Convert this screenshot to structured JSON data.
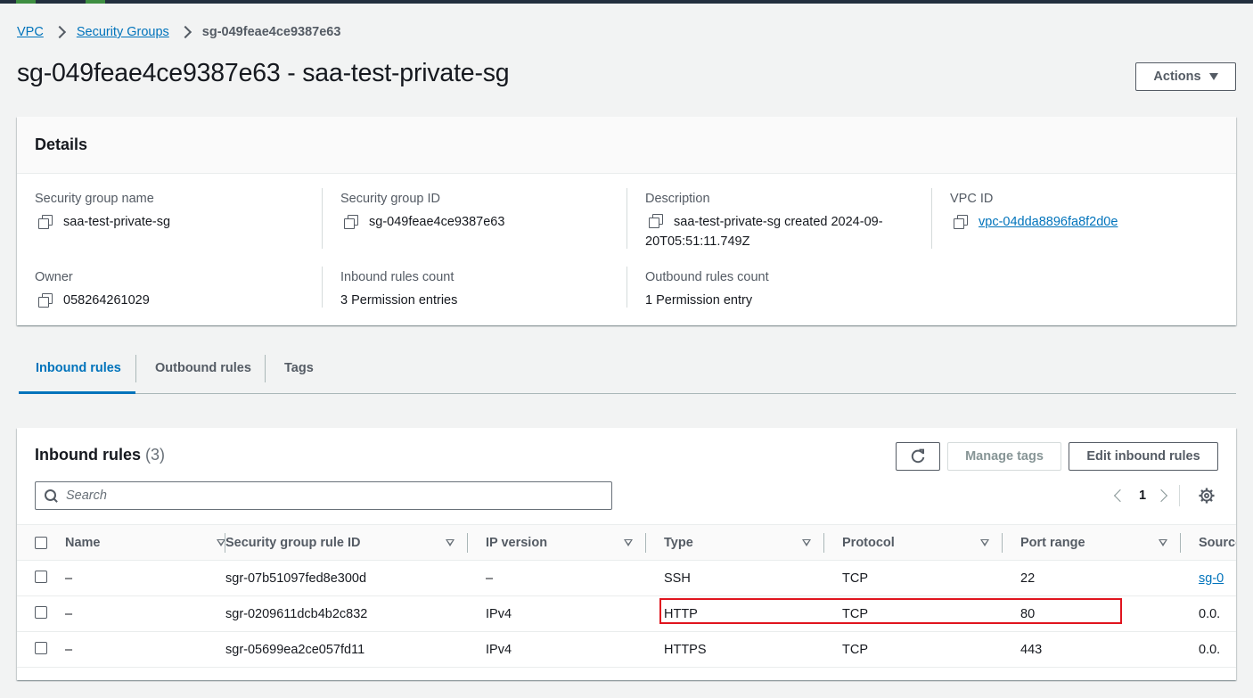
{
  "colors": {
    "link": "#0073bb",
    "highlight": "#e0141e",
    "topbar": "#232f3e"
  },
  "breadcrumb": {
    "items": [
      "VPC",
      "Security Groups"
    ],
    "current": "sg-049feae4ce9387e63"
  },
  "page": {
    "title": "sg-049feae4ce9387e63 - saa-test-private-sg",
    "actions_label": "Actions"
  },
  "details": {
    "heading": "Details",
    "fields": [
      {
        "label": "Security group name",
        "value": "saa-test-private-sg"
      },
      {
        "label": "Security group ID",
        "value": "sg-049feae4ce9387e63"
      },
      {
        "label": "Description",
        "value": "saa-test-private-sg created 2024-09-20T05:51:11.749Z"
      },
      {
        "label": "VPC ID",
        "value": "vpc-04dda8896fa8f2d0e"
      },
      {
        "label": "Owner",
        "value": "058264261029"
      },
      {
        "label": "Inbound rules count",
        "value": "3 Permission entries"
      },
      {
        "label": "Outbound rules count",
        "value": "1 Permission entry"
      }
    ]
  },
  "tabs": [
    {
      "label": "Inbound rules",
      "active": true
    },
    {
      "label": "Outbound rules",
      "active": false
    },
    {
      "label": "Tags",
      "active": false
    }
  ],
  "inbound": {
    "title": "Inbound rules",
    "count": "(3)",
    "manage_tags_label": "Manage tags",
    "edit_label": "Edit inbound rules",
    "search_placeholder": "Search",
    "page_number": "1",
    "columns": [
      "Name",
      "Security group rule ID",
      "IP version",
      "Type",
      "Protocol",
      "Port range",
      "Source"
    ],
    "rows": [
      {
        "name": "–",
        "rule_id": "sgr-07b51097fed8e300d",
        "ip_version": "–",
        "type": "SSH",
        "protocol": "TCP",
        "port_range": "22",
        "source": "sg-0"
      },
      {
        "name": "–",
        "rule_id": "sgr-0209611dcb4b2c832",
        "ip_version": "IPv4",
        "type": "HTTP",
        "protocol": "TCP",
        "port_range": "80",
        "source": "0.0."
      },
      {
        "name": "–",
        "rule_id": "sgr-05699ea2ce057fd11",
        "ip_version": "IPv4",
        "type": "HTTPS",
        "protocol": "TCP",
        "port_range": "443",
        "source": "0.0."
      }
    ]
  }
}
